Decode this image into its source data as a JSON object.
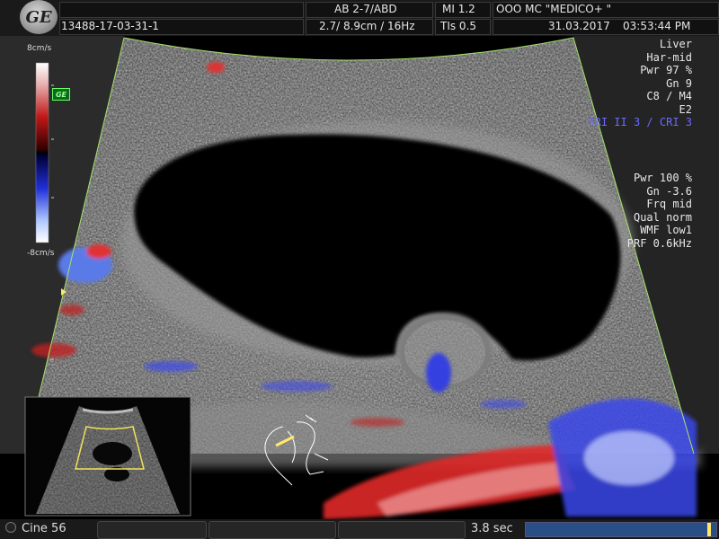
{
  "header": {
    "logo_text": "GE",
    "patient_id": "13488-17-03-31-1",
    "probe_preset": "AB 2-7/ABD",
    "depth_freq": "2.7/ 8.9cm / 16Hz",
    "mi": "MI  1.2",
    "tis": "TIs  0.5",
    "institution": "OOO  MC \"MEDICO+ \"",
    "date": "31.03.2017",
    "time": "03:53:44 PM"
  },
  "colorbar": {
    "top_label": "8cm/s",
    "bottom_label": "-8cm/s",
    "badge": "GE"
  },
  "bmode_params": [
    "Liver",
    "Har-mid",
    "Pwr  97 %",
    "Gn  9",
    "C8 / M4",
    "E2"
  ],
  "sri_label": "SRI II 3 / CRI 3",
  "color_params": [
    "Pwr 100 %",
    "Gn -3.6",
    "Frq mid",
    "Qual norm",
    "WMF low1",
    "PRF  0.6kHz"
  ],
  "footer": {
    "cine_label": "Cine 56",
    "duration": "3.8 sec",
    "cine_position": 0.97
  },
  "colors": {
    "sector_outline": "#a6e36a",
    "doppler_red": "#d9262a",
    "doppler_blue": "#3b45e8",
    "param_blue": "#6a6aff"
  }
}
